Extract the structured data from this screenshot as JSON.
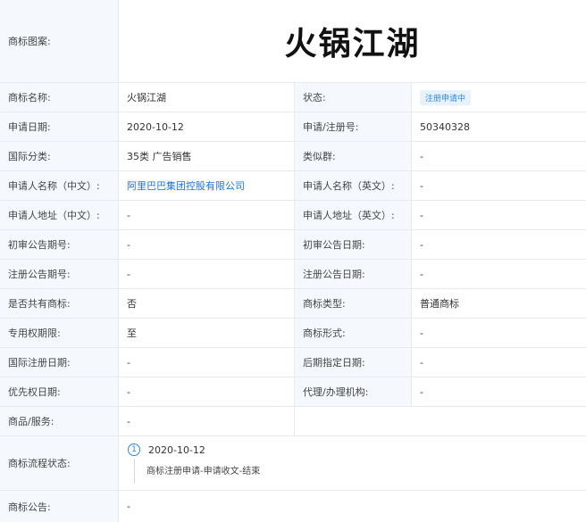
{
  "trademark": {
    "pattern_label": "商标图案:",
    "pattern_text": "火锅江湖",
    "name_label": "商标名称:",
    "name_value": "火锅江湖",
    "status_label": "状态:",
    "status_value": "注册申请中",
    "apply_date_label": "申请日期:",
    "apply_date_value": "2020-10-12",
    "reg_no_label": "申请/注册号:",
    "reg_no_value": "50340328",
    "intl_class_label": "国际分类:",
    "intl_class_value": "35类 广告销售",
    "similar_group_label": "类似群:",
    "similar_group_value": "-",
    "applicant_cn_label": "申请人名称（中文）:",
    "applicant_cn_value": "阿里巴巴集团控股有限公司",
    "applicant_en_label": "申请人名称（英文）:",
    "applicant_en_value": "-",
    "address_cn_label": "申请人地址（中文）:",
    "address_cn_value": "-",
    "address_en_label": "申请人地址（英文）:",
    "address_en_value": "-",
    "prelim_pub_no_label": "初审公告期号:",
    "prelim_pub_no_value": "-",
    "prelim_pub_date_label": "初审公告日期:",
    "prelim_pub_date_value": "-",
    "reg_pub_no_label": "注册公告期号:",
    "reg_pub_no_value": "-",
    "reg_pub_date_label": "注册公告日期:",
    "reg_pub_date_value": "-",
    "shared_label": "是否共有商标:",
    "shared_value": "否",
    "type_label": "商标类型:",
    "type_value": "普通商标",
    "exclusive_period_label": "专用权期限:",
    "exclusive_period_value": "至",
    "form_label": "商标形式:",
    "form_value": "-",
    "intl_reg_date_label": "国际注册日期:",
    "intl_reg_date_value": "-",
    "later_designation_label": "后期指定日期:",
    "later_designation_value": "-",
    "priority_date_label": "优先权日期:",
    "priority_date_value": "-",
    "agency_label": "代理/办理机构:",
    "agency_value": "-",
    "goods_label": "商品/服务:",
    "goods_value": "-",
    "flow_label": "商标流程状态:",
    "flow_step_number": "1",
    "flow_date": "2020-10-12",
    "flow_desc": "商标注册申请-申请收文-结束",
    "announcement_label": "商标公告:",
    "announcement_value": "-"
  },
  "colors": {
    "label_bg": "#f5f9fd",
    "border": "#e6ebf1",
    "link": "#1a73d9",
    "badge_bg": "#e8f2fd",
    "badge_text": "#2f86de"
  }
}
